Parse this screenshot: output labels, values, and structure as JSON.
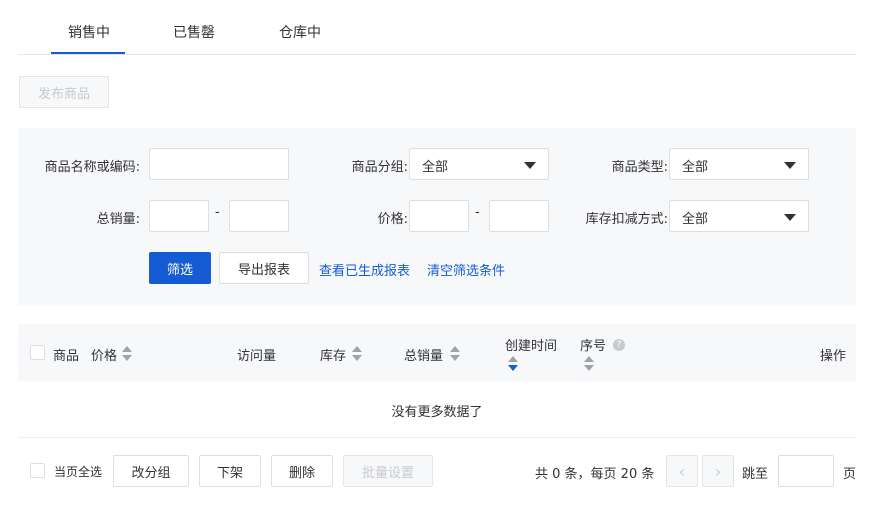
{
  "tabs": [
    {
      "label": "销售中",
      "active": true
    },
    {
      "label": "已售罄",
      "active": false
    },
    {
      "label": "仓库中",
      "active": false
    }
  ],
  "publish_button": "发布商品",
  "filter": {
    "name_label": "商品名称或编码:",
    "name_value": "",
    "group_label": "商品分组:",
    "group_value": "全部",
    "type_label": "商品类型:",
    "type_value": "全部",
    "sales_label": "总销量:",
    "sales_min": "",
    "sales_max": "",
    "range_sep": "-",
    "price_label": "价格:",
    "price_min": "",
    "price_max": "",
    "stock_mode_label": "库存扣减方式:",
    "stock_mode_value": "全部",
    "filter_button": "筛选",
    "export_button": "导出报表",
    "view_reports_link": "查看已生成报表",
    "clear_link": "清空筛选条件"
  },
  "table": {
    "headers": {
      "product": "商品",
      "price": "价格",
      "visits": "访问量",
      "stock": "库存",
      "total_sales": "总销量",
      "created_time": "创建时间",
      "serial": "序号",
      "actions": "操作"
    },
    "sorted_column": "created_time",
    "sort_direction": "desc",
    "rows": [],
    "empty_text": "没有更多数据了"
  },
  "footer": {
    "select_all_label": "当页全选",
    "change_group_button": "改分组",
    "delist_button": "下架",
    "delete_button": "删除",
    "batch_settings_button": "批量设置",
    "summary": "共 0 条，每页 20 条",
    "jump_label": "跳至",
    "jump_value": "",
    "page_unit": "页"
  },
  "colors": {
    "accent": "#155bd4",
    "panel_bg": "#f7f8fa",
    "border": "#dcdee0"
  },
  "icons": {
    "sort": "sort-caret-icon",
    "select_caret": "caret-down-icon",
    "help": "question-circle-icon",
    "prev": "chevron-left-icon",
    "next": "chevron-right-icon"
  }
}
